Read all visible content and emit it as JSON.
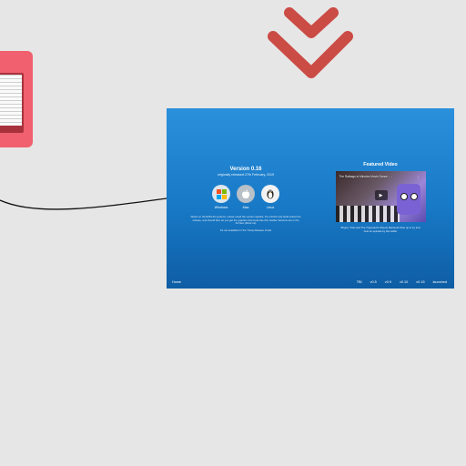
{
  "side_card": {},
  "slide": {
    "version_title": "Version 0.16",
    "version_subtitle": "originally released 27th February, 2019",
    "os_buttons": [
      {
        "label": "Windows",
        "icon": "windows-icon"
      },
      {
        "label": "Mac",
        "icon": "apple-icon"
      },
      {
        "label": "Linux",
        "icon": "linux-icon"
      }
    ],
    "description": "Works on 32-bit/64-bit systems, unless noted the version applies. It's a 64-bit only build unless the release, and should then let you get the graphics that looks like this. Earlier Versions are in the Archive (Wow! ok)",
    "note": "It's not available for the Trusty Release of last",
    "featured_title": "Featured Video",
    "video": {
      "title": "The Ratbags to Minutes Movie Dance - ...",
      "menu_glyph": "⋮",
      "play_glyph": "▶"
    },
    "video_caption": "Brigory Trots and The Trigonauti's Sheets Retrieval show up to try and host an episode by the Hoffer",
    "footer": {
      "home": "Home",
      "links": [
        "TBI",
        "v0.5",
        "v0.9",
        "v0.10",
        "v0.15",
        "launched"
      ]
    }
  },
  "colors": {
    "chevron": "#cb4b45",
    "slide_top": "#2b90dc",
    "slide_bottom": "#0e5da4",
    "side_card": "#f0606e"
  }
}
